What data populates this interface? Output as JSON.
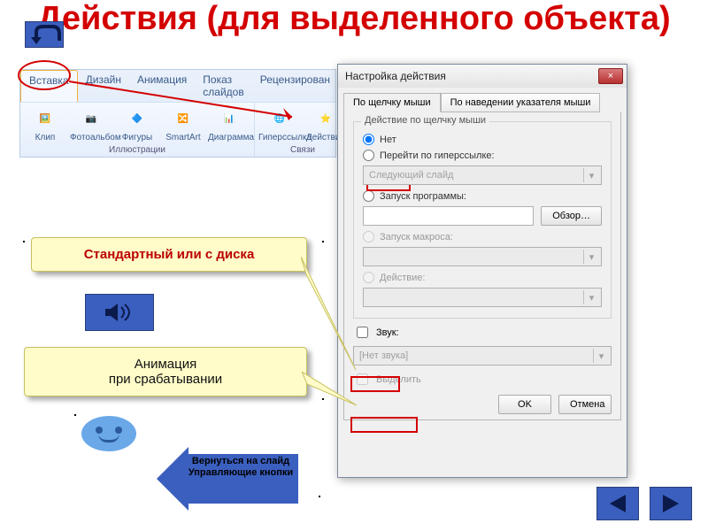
{
  "title": "Действия (для выделенного объекта)",
  "ribbon": {
    "tabs": [
      "Вставка",
      "Дизайн",
      "Анимация",
      "Показ слайдов",
      "Рецензирован"
    ],
    "active_tab": "Вставка",
    "group_illustrations": {
      "label": "Иллюстрации",
      "items": [
        "Клип",
        "Фотоальбом",
        "Фигуры",
        "SmartArt",
        "Диаграмма"
      ]
    },
    "group_links": {
      "label": "Связи",
      "items": [
        "Гиперссылка",
        "Действие"
      ]
    }
  },
  "dialog": {
    "title": "Настройка действия",
    "close": "×",
    "tabs": {
      "click": "По щелчку мыши",
      "hover": "По наведении указателя мыши"
    },
    "group_legend": "Действие по щелчку мыши",
    "options": {
      "none": "Нет",
      "hyperlink": "Перейти по гиперссылке:",
      "hyperlink_value": "Следующий слайд",
      "run_program": "Запуск программы:",
      "browse": "Обзор…",
      "run_macro": "Запуск макроса:",
      "action": "Действие:"
    },
    "sound_check": "Звук:",
    "sound_value": "[Нет звука]",
    "highlight_check": "Выделить",
    "ok": "OK",
    "cancel": "Отмена"
  },
  "callouts": {
    "standard": "Стандартный или с диска",
    "animation1": "Анимация",
    "animation2": "при срабатывании"
  },
  "return_arrow": "Вернуться на слайд Управляющие кнопки",
  "icons": {
    "back": "u-turn-arrow",
    "speaker": "speaker-icon",
    "prev": "triangle-left",
    "next": "triangle-right"
  }
}
